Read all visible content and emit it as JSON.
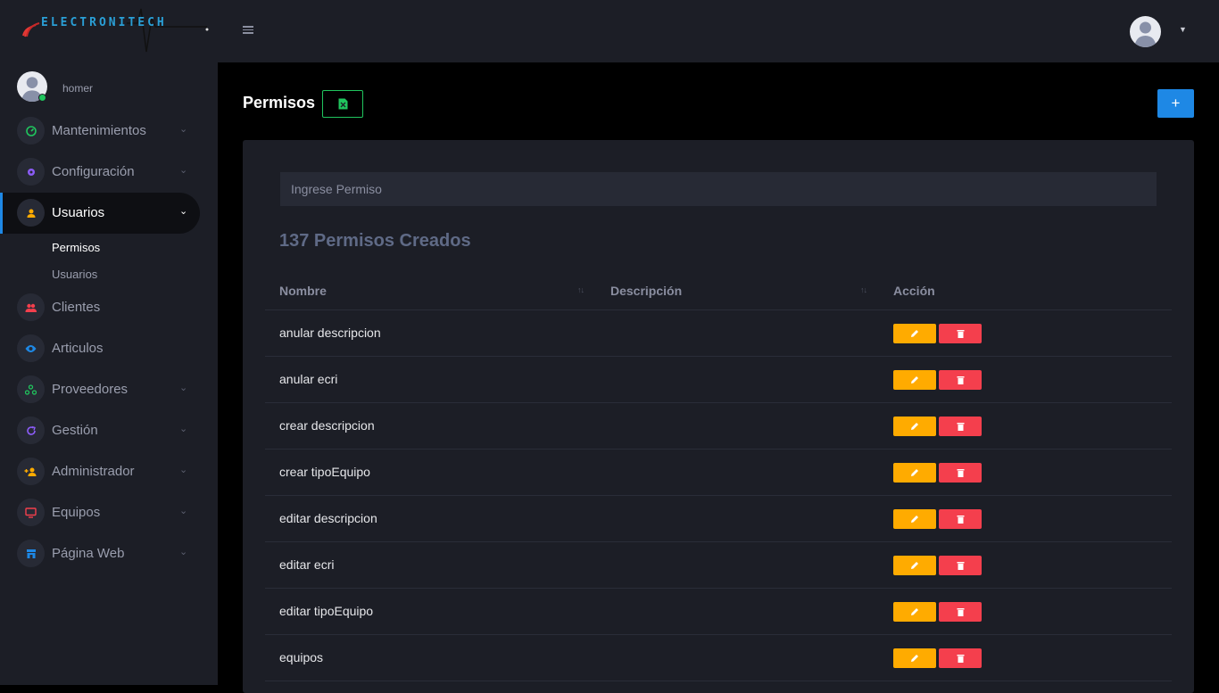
{
  "brand": {
    "logo_text": "ELECTRONITECH"
  },
  "user": {
    "name": "homer"
  },
  "sidebar": {
    "items": [
      {
        "label": "Mantenimientos",
        "icon": "gauge-icon",
        "color": "#20c55e",
        "chevron": "⌄"
      },
      {
        "label": "Configuración",
        "icon": "gear-icon",
        "color": "#8b5cf6",
        "chevron": "⌄"
      },
      {
        "label": "Usuarios",
        "icon": "user-icon",
        "color": "#ffab00",
        "chevron": "⌄",
        "active": true
      },
      {
        "label": "Clientes",
        "icon": "users-icon",
        "color": "#f43f4d"
      },
      {
        "label": "Articulos",
        "icon": "eye-icon",
        "color": "#1e88e5"
      },
      {
        "label": "Proveedores",
        "icon": "network-icon",
        "color": "#20c55e",
        "chevron": "⌄"
      },
      {
        "label": "Gestión",
        "icon": "refresh-icon",
        "color": "#8b5cf6",
        "chevron": "⌄"
      },
      {
        "label": "Administrador",
        "icon": "user-plus-icon",
        "color": "#ffab00",
        "chevron": "⌄"
      },
      {
        "label": "Equipos",
        "icon": "monitor-icon",
        "color": "#f43f4d",
        "chevron": "⌄"
      },
      {
        "label": "Página Web",
        "icon": "store-icon",
        "color": "#1e88e5",
        "chevron": "⌄"
      }
    ],
    "subitems": [
      {
        "label": "Permisos",
        "current": true
      },
      {
        "label": "Usuarios"
      }
    ]
  },
  "main": {
    "title": "Permisos",
    "add_label": "+",
    "search_placeholder": "Ingrese Permiso",
    "count_title": "137 Permisos Creados",
    "columns": [
      "Nombre",
      "Descripción",
      "Acción"
    ],
    "rows": [
      {
        "name": "anular descripcion"
      },
      {
        "name": "anular ecri"
      },
      {
        "name": "crear descripcion"
      },
      {
        "name": "crear tipoEquipo"
      },
      {
        "name": "editar descripcion"
      },
      {
        "name": "editar ecri"
      },
      {
        "name": "editar tipoEquipo"
      },
      {
        "name": "equipos"
      }
    ]
  },
  "colors": {
    "accent": "#1e88e5",
    "edit": "#ffab00",
    "delete": "#f43f4d",
    "excel": "#20c55e"
  }
}
